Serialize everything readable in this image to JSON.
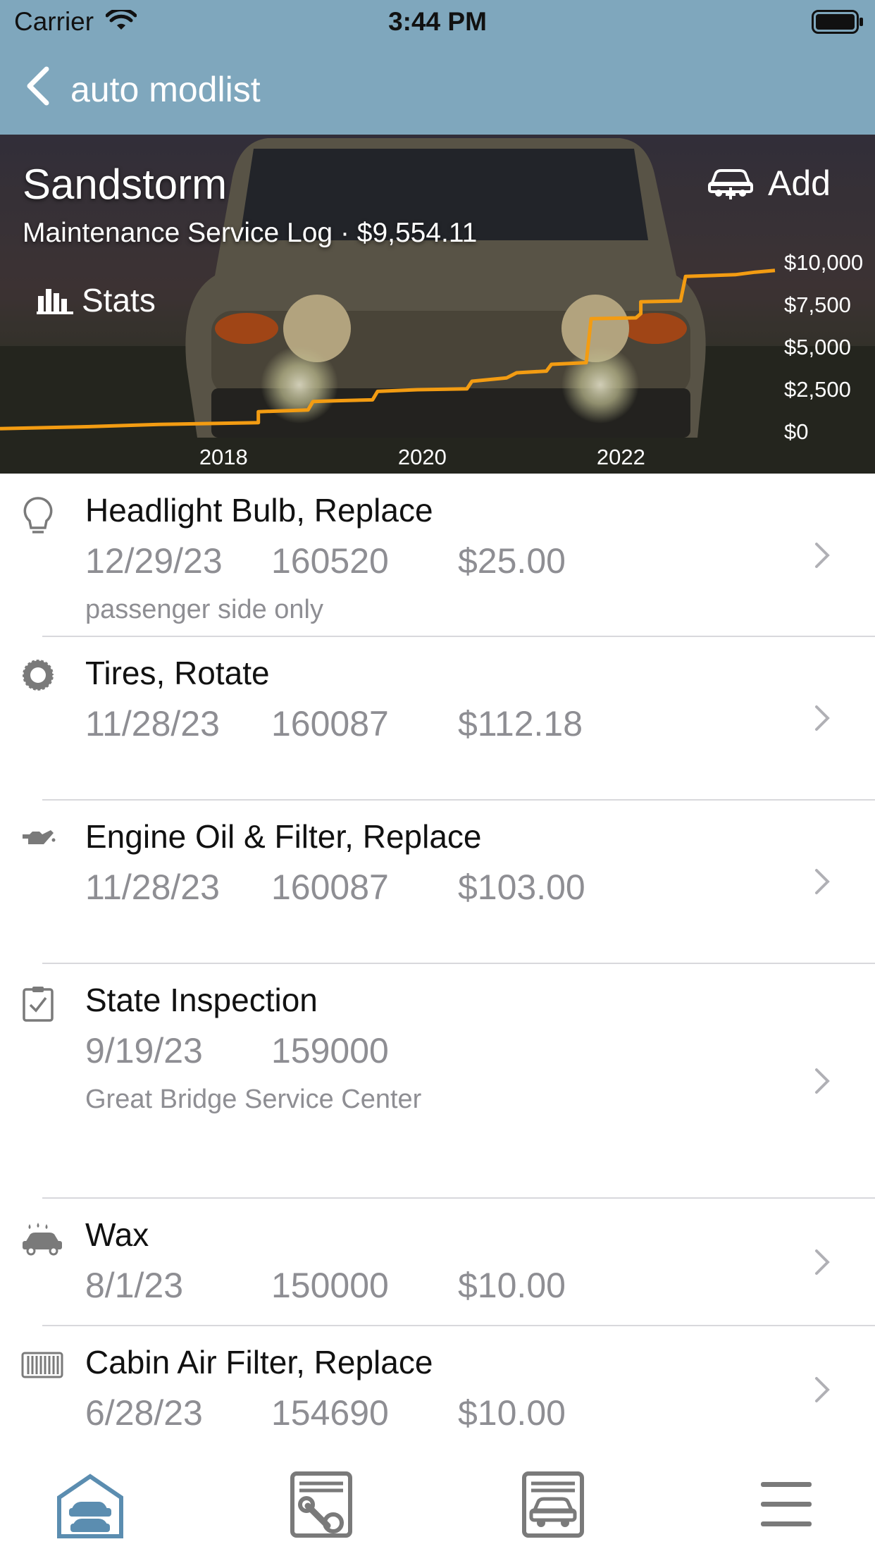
{
  "status": {
    "carrier": "Carrier",
    "time": "3:44 PM"
  },
  "nav": {
    "back_label": "auto modlist"
  },
  "hero": {
    "title": "Sandstorm",
    "subtitle": "Maintenance Service Log · $9,554.11",
    "add_label": "Add",
    "stats_label": "Stats"
  },
  "chart_data": {
    "type": "line",
    "x_ticks": [
      "2018",
      "2020",
      "2022"
    ],
    "y_ticks": [
      "$10,000",
      "$7,500",
      "$5,000",
      "$2,500",
      "$0"
    ],
    "ylim": [
      0,
      10000
    ],
    "series": [
      {
        "color": "#f39c12",
        "x": [
          2016.2,
          2017.0,
          2017.8,
          2018.8,
          2018.8,
          2019.3,
          2019.35,
          2019.6,
          2019.95,
          2020.0,
          2020.4,
          2020.9,
          2020.95,
          2021.3,
          2021.4,
          2021.7,
          2021.75,
          2022.1,
          2022.15,
          2022.6,
          2022.65,
          2022.65,
          2023.05,
          2023.1,
          2023.6,
          2023.8,
          2024.0
        ],
        "y": [
          200,
          300,
          450,
          550,
          1200,
          1300,
          1800,
          1850,
          1900,
          2400,
          2500,
          2550,
          3000,
          3200,
          3500,
          3600,
          4000,
          4100,
          6700,
          6750,
          7000,
          7700,
          7750,
          9200,
          9300,
          9450,
          9554
        ]
      }
    ]
  },
  "entries": [
    {
      "icon": "lightbulb-icon",
      "title": "Headlight Bulb, Replace",
      "date": "12/29/23",
      "odometer": "160520",
      "cost": "$25.00",
      "note": "passenger side only"
    },
    {
      "icon": "tire-icon",
      "title": "Tires, Rotate",
      "date": "11/28/23",
      "odometer": "160087",
      "cost": "$112.18",
      "note": ""
    },
    {
      "icon": "oil-can-icon",
      "title": "Engine Oil & Filter, Replace",
      "date": "11/28/23",
      "odometer": "160087",
      "cost": "$103.00",
      "note": ""
    },
    {
      "icon": "checklist-icon",
      "title": "State Inspection",
      "date": "9/19/23",
      "odometer": "159000",
      "cost": "",
      "note": "Great Bridge Service Center"
    },
    {
      "icon": "car-wash-icon",
      "title": "Wax",
      "date": "8/1/23",
      "odometer": "150000",
      "cost": "$10.00",
      "note": ""
    },
    {
      "icon": "air-filter-icon",
      "title": "Cabin Air Filter, Replace",
      "date": "6/28/23",
      "odometer": "154690",
      "cost": "$10.00",
      "note": ""
    }
  ],
  "tabs": [
    {
      "icon": "garage-icon",
      "active": true
    },
    {
      "icon": "service-log-icon",
      "active": false
    },
    {
      "icon": "vehicle-card-icon",
      "active": false
    },
    {
      "icon": "menu-icon",
      "active": false
    }
  ],
  "colors": {
    "nav": "#7fa7bd",
    "chart_line": "#f39c12",
    "secondary_text": "#8e8e93",
    "tab_active": "#5b8db0",
    "tab_inactive": "#7a7a7a"
  }
}
